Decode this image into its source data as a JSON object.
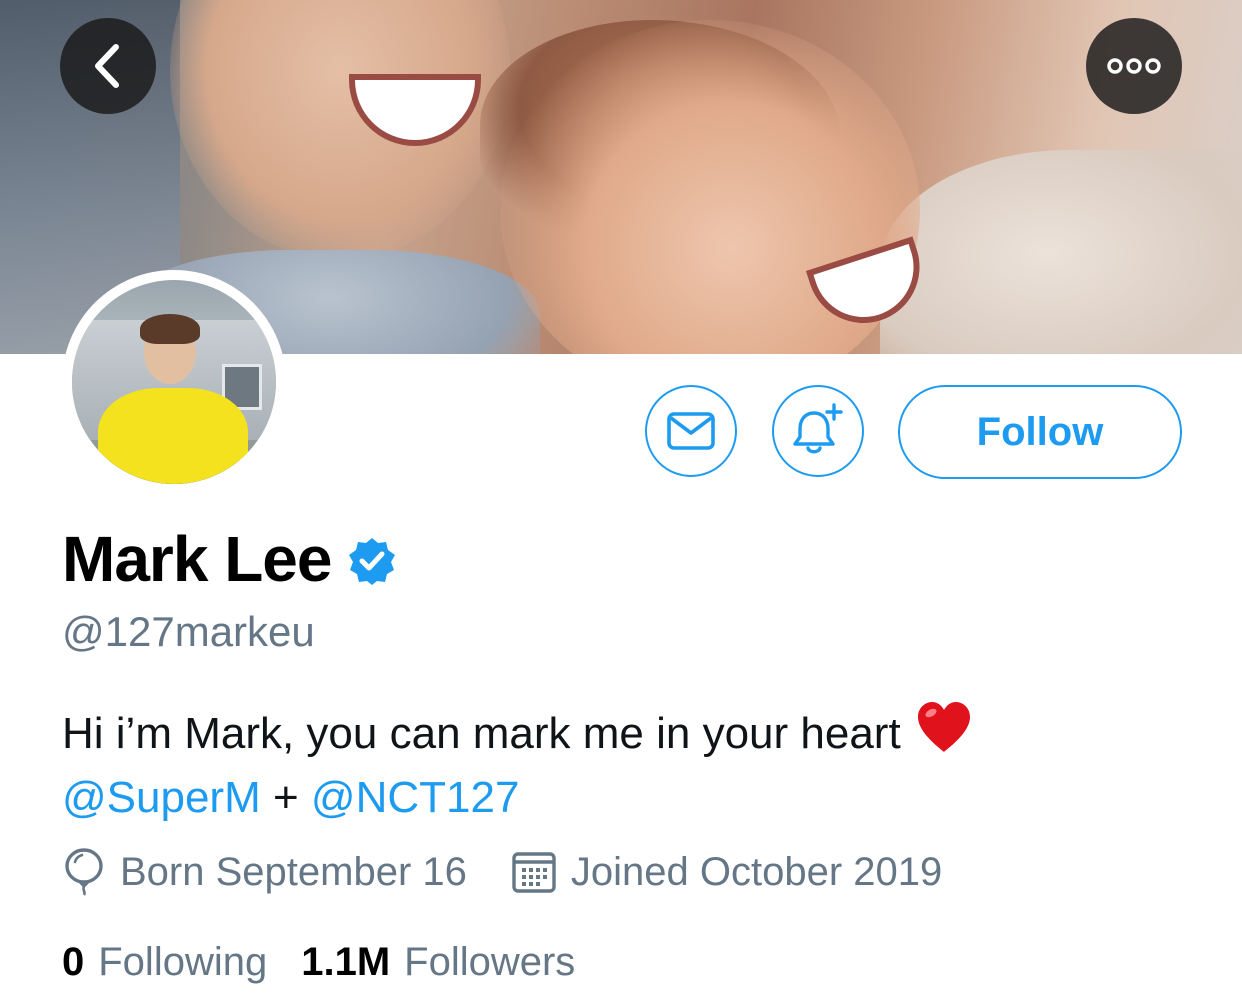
{
  "profile": {
    "name": "Mark Lee",
    "handle": "@127markeu",
    "verified": true,
    "bio": {
      "text": "Hi i’m Mark, you can mark me in your heart",
      "emoji": "heart-emoji",
      "mention_1": "@SuperM",
      "separator": "+",
      "mention_2": "@NCT127"
    },
    "born": "Born September 16",
    "joined": "Joined October 2019"
  },
  "stats": {
    "following_count": "0",
    "following_label": "Following",
    "followers_count": "1.1M",
    "followers_label": "Followers"
  },
  "actions": {
    "follow_label": "Follow",
    "message_icon": "envelope-icon",
    "notify_icon": "bell-plus-icon",
    "back_icon": "chevron-left-icon",
    "more_icon": "more-dots-icon"
  },
  "colors": {
    "accent": "#1d9bf0",
    "muted_text": "#657786",
    "primary_text": "#0f1419"
  }
}
